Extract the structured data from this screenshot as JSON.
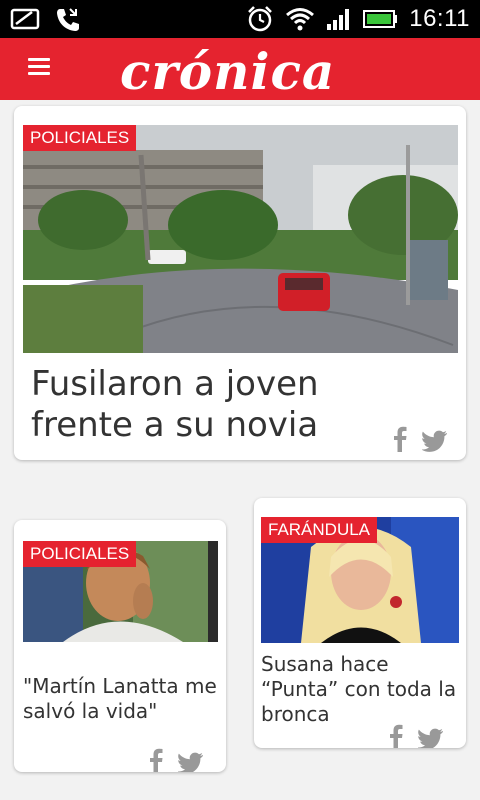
{
  "status": {
    "time": "16:11"
  },
  "header": {
    "logo": "crónica"
  },
  "articles": [
    {
      "category": "POLICIALES",
      "title": "Fusilaron a joven frente a su novia"
    },
    {
      "category": "POLICIALES",
      "title": "\"Martín Lanatta me salvó la vida\""
    },
    {
      "category": "FARÁNDULA",
      "title": "Susana hace “Punta” con toda la bronca"
    }
  ],
  "colors": {
    "brand": "#e5232f",
    "statusbar": "#000000",
    "card": "#ffffff",
    "background": "#f2f2f2"
  }
}
